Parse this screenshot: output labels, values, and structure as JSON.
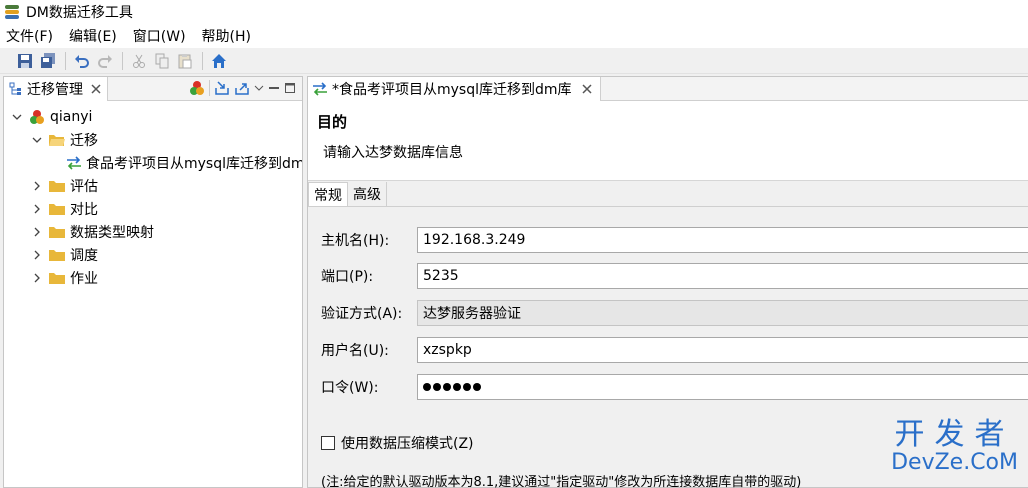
{
  "app": {
    "title": "DM数据迁移工具"
  },
  "menu": [
    "文件(F)",
    "编辑(E)",
    "窗口(W)",
    "帮助(H)"
  ],
  "toolbar": {
    "icons": [
      "save-icon",
      "save-all-icon",
      "undo-icon",
      "redo-icon",
      "cut-icon",
      "copy-icon",
      "paste-icon",
      "home-icon"
    ]
  },
  "left_view": {
    "tab_label": "迁移管理",
    "tree": {
      "root": "qianyi",
      "migration_folder": "迁移",
      "migration_item": "食品考评项目从mysql库迁移到dm库",
      "folders": [
        "评估",
        "对比",
        "数据类型映射",
        "调度",
        "作业"
      ]
    }
  },
  "editor": {
    "tab_label": "*食品考评项目从mysql库迁移到dm库",
    "heading": "目的",
    "description": "请输入达梦数据库信息",
    "tabs": [
      "常规",
      "高级"
    ],
    "fields": {
      "host_label": "主机名(H):",
      "host_value": "192.168.3.249",
      "port_label": "端口(P):",
      "port_value": "5235",
      "auth_label": "验证方式(A):",
      "auth_value": "达梦服务器验证",
      "user_label": "用户名(U):",
      "user_value": "xzspkp",
      "password_label": "口令(W):",
      "password_length": 6
    },
    "compress_label": "使用数据压缩模式(Z)",
    "compress_checked": false,
    "note": "(注:给定的默认驱动版本为8.1,建议通过\"指定驱动\"修改为所连接数据库自带的驱动)"
  },
  "watermark": {
    "line1": "开发者",
    "line2": "DevZe.CoM"
  },
  "colors": {
    "folder": "#e8b73a",
    "accent_blue": "#2a6fc9",
    "window_bg": "#f0f0f0"
  }
}
